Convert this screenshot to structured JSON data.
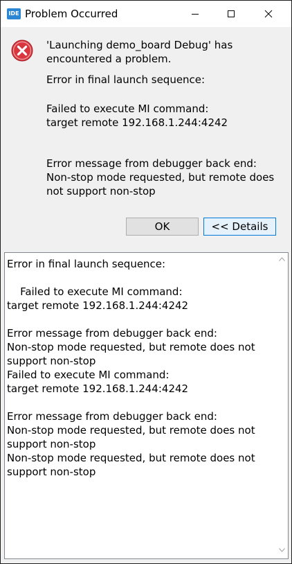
{
  "window": {
    "app_icon": "IDE",
    "title": "Problem Occurred",
    "controls": [
      "minimize-icon",
      "maximize-icon",
      "close-icon"
    ]
  },
  "message": {
    "headline_line1": "'Launching demo_board Debug' has",
    "headline_line2": "encountered a problem.",
    "sequence": "Error in final launch sequence:",
    "failed_line1": "Failed to execute MI command:",
    "failed_line2": "target remote 192.168.1.244:4242",
    "debugger_line1": "Error message from debugger back end:",
    "debugger_line2": "Non-stop mode requested, but remote does",
    "debugger_line3": "not support non-stop"
  },
  "buttons": {
    "ok": "OK",
    "details": "<< Details"
  },
  "details": {
    "text": "Error in final launch sequence:\n\n    Failed to execute MI command:\ntarget remote 192.168.1.244:4242\n\nError message from debugger back end:\nNon-stop mode requested, but remote does not\nsupport non-stop\nFailed to execute MI command:\ntarget remote 192.168.1.244:4242\n\nError message from debugger back end:\nNon-stop mode requested, but remote does not\nsupport non-stop\nNon-stop mode requested, but remote does not\nsupport non-stop"
  },
  "colors": {
    "error_red": "#d9363e",
    "focus_blue": "#0078d7",
    "app_icon_blue": "#2b86d4"
  }
}
